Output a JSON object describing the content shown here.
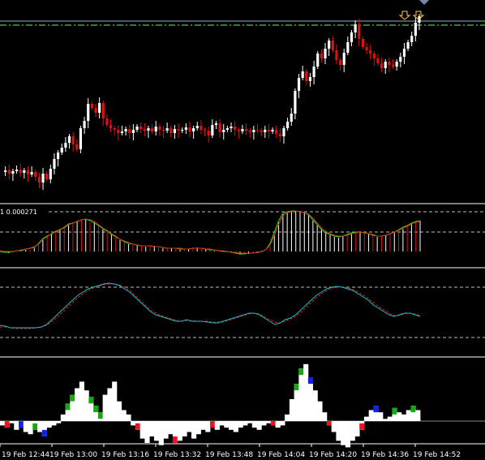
{
  "colors": {
    "background": "#000000",
    "bull_candle": "#ffffff",
    "bear_candle": "#dd1111",
    "resistance_line": "#22bb22",
    "level_line": "#9aaac8",
    "separator": "#ffffff",
    "dashed_level": "#bbbbbb",
    "arrow": "#ffcc33",
    "fast_line": "#22dd22",
    "slow_line": "#dd3311",
    "main_line": "#22bbcc",
    "signal_line": "#dd2222",
    "hist_white": "#ffffff",
    "hist_green": "#11aa11",
    "hist_blue": "#1122ee",
    "hist_red": "#ee1122"
  },
  "indicator_label": "1 0.000271",
  "time_axis": [
    "19 Feb 12:44",
    "19 Feb 13:00",
    "19 Feb 13:16",
    "19 Feb 13:32",
    "19 Feb 13:48",
    "19 Feb 14:04",
    "19 Feb 14:20",
    "19 Feb 14:36",
    "19 Feb 14:52"
  ],
  "price_closes": [
    212,
    210,
    214,
    211,
    209,
    213,
    210,
    215,
    212,
    218,
    225,
    214,
    221,
    208,
    196,
    188,
    182,
    176,
    168,
    178,
    184,
    158,
    149,
    128,
    133,
    139,
    127,
    146,
    154,
    158,
    160,
    164,
    162,
    159,
    164,
    160,
    156,
    159,
    161,
    158,
    162,
    156,
    160,
    161,
    158,
    164,
    159,
    161,
    160,
    157,
    162,
    158,
    155,
    160,
    161,
    167,
    154,
    152,
    163,
    160,
    158,
    156,
    160,
    162,
    159,
    161,
    163,
    160,
    161,
    163,
    160,
    162,
    160,
    165,
    168,
    158,
    150,
    140,
    112,
    96,
    88,
    100,
    95,
    82,
    66,
    72,
    60,
    50,
    62,
    74,
    80,
    65,
    52,
    40,
    30,
    48,
    58,
    62,
    66,
    72,
    78,
    84,
    76,
    80,
    82,
    76,
    70,
    60,
    52,
    44,
    28,
    20
  ],
  "macd_histogram": [
    310,
    310,
    312,
    311,
    310,
    309,
    308,
    308,
    306,
    302,
    296,
    292,
    288,
    286,
    282,
    279,
    277,
    274,
    272,
    270,
    270,
    274,
    274,
    277,
    283,
    286,
    288,
    293,
    296,
    299,
    301,
    302,
    302,
    303,
    304,
    303,
    303,
    305,
    306,
    306,
    306,
    307,
    308,
    307,
    307,
    305,
    305,
    307,
    307,
    308,
    309,
    309,
    310,
    311,
    311,
    312,
    314,
    313,
    313,
    312,
    312,
    311,
    310,
    304,
    290,
    274,
    264,
    262,
    260,
    261,
    260,
    262,
    264,
    272,
    278,
    282,
    286,
    290,
    292,
    293,
    291,
    290,
    287,
    286,
    285,
    286,
    288,
    290,
    292,
    291,
    290,
    288,
    286,
    284,
    282,
    279,
    276,
    273,
    272
  ],
  "macd_fast": [
    310,
    311,
    311,
    310,
    309,
    309,
    307,
    306,
    305,
    300,
    294,
    291,
    289,
    285,
    283,
    280,
    276,
    275,
    273,
    271,
    270,
    272,
    275,
    278,
    282,
    285,
    289,
    292,
    295,
    298,
    300,
    301,
    302,
    303,
    303,
    303,
    304,
    304,
    305,
    306,
    306,
    306,
    307,
    307,
    307,
    306,
    306,
    306,
    307,
    308,
    308,
    309,
    310,
    310,
    311,
    312,
    313,
    313,
    312,
    312,
    311,
    310,
    308,
    300,
    286,
    272,
    263,
    261,
    260,
    260,
    261,
    262,
    265,
    271,
    277,
    283,
    287,
    289,
    291,
    292,
    291,
    289,
    287,
    286,
    286,
    287,
    288,
    290,
    291,
    291,
    290,
    288,
    286,
    283,
    280,
    278,
    275,
    273,
    272
  ],
  "macd_slow": [
    309,
    310,
    310,
    310,
    309,
    308,
    307,
    306,
    304,
    301,
    295,
    292,
    288,
    286,
    283,
    281,
    277,
    275,
    273,
    271,
    270,
    271,
    273,
    277,
    281,
    284,
    288,
    291,
    295,
    297,
    299,
    301,
    302,
    303,
    303,
    303,
    304,
    304,
    305,
    306,
    306,
    306,
    306,
    307,
    307,
    306,
    306,
    306,
    307,
    307,
    308,
    309,
    309,
    310,
    311,
    311,
    312,
    312,
    312,
    312,
    311,
    310,
    308,
    302,
    290,
    276,
    266,
    262,
    261,
    260,
    261,
    262,
    264,
    269,
    275,
    281,
    285,
    288,
    290,
    291,
    291,
    290,
    288,
    287,
    286,
    287,
    288,
    289,
    291,
    291,
    290,
    288,
    286,
    284,
    281,
    279,
    276,
    274,
    273
  ],
  "osc_main": [
    401,
    402,
    404,
    404,
    404,
    404,
    404,
    404,
    403,
    400,
    394,
    388,
    382,
    376,
    370,
    364,
    360,
    356,
    354,
    352,
    350,
    349,
    350,
    352,
    356,
    360,
    366,
    372,
    378,
    384,
    388,
    390,
    392,
    394,
    396,
    396,
    394,
    396,
    396,
    396,
    397,
    398,
    398,
    396,
    394,
    392,
    390,
    388,
    386,
    386,
    388,
    392,
    396,
    400,
    398,
    394,
    392,
    388,
    382,
    376,
    370,
    364,
    360,
    356,
    354,
    353,
    354,
    356,
    358,
    362,
    366,
    370,
    376,
    380,
    384,
    388,
    390,
    388,
    386,
    386,
    388,
    390
  ],
  "osc_signal": [
    403,
    403,
    404,
    405,
    405,
    405,
    405,
    404,
    403,
    401,
    396,
    391,
    385,
    379,
    373,
    367,
    362,
    358,
    355,
    353,
    351,
    350,
    350,
    351,
    354,
    358,
    364,
    370,
    376,
    382,
    386,
    389,
    391,
    393,
    395,
    396,
    395,
    395,
    396,
    396,
    396,
    397,
    397,
    397,
    395,
    393,
    391,
    389,
    387,
    386,
    387,
    391,
    394,
    397,
    398,
    396,
    393,
    390,
    385,
    379,
    373,
    367,
    362,
    358,
    355,
    354,
    354,
    355,
    357,
    360,
    364,
    368,
    373,
    378,
    382,
    386,
    389,
    389,
    387,
    386,
    387,
    389
  ],
  "hist_main": [
    -4,
    -6,
    -2,
    -8,
    -6,
    -10,
    -12,
    -8,
    -10,
    -14,
    -6,
    -4,
    -2,
    6,
    16,
    24,
    30,
    36,
    28,
    22,
    14,
    8,
    24,
    30,
    36,
    18,
    10,
    6,
    -4,
    -8,
    -16,
    -20,
    -14,
    -18,
    -22,
    -16,
    -12,
    -20,
    -18,
    -14,
    -10,
    -16,
    -12,
    -8,
    -10,
    -6,
    -8,
    -4,
    -6,
    -8,
    -10,
    -6,
    -4,
    -2,
    -6,
    -8,
    -4,
    -2,
    -4,
    -6,
    -4,
    6,
    20,
    34,
    48,
    52,
    40,
    28,
    18,
    8,
    -4,
    -10,
    -18,
    -22,
    -24,
    -18,
    -14,
    -8,
    4,
    10,
    14,
    8,
    2,
    4,
    12,
    8,
    6,
    10,
    14,
    10
  ],
  "hist_tone": [
    "w",
    "r",
    "w",
    "w",
    "b",
    "w",
    "w",
    "g",
    "w",
    "b",
    "w",
    "w",
    "w",
    "w",
    "g",
    "g",
    "w",
    "w",
    "w",
    "g",
    "g",
    "g",
    "w",
    "w",
    "w",
    "w",
    "w",
    "w",
    "w",
    "r",
    "w",
    "w",
    "w",
    "w",
    "w",
    "w",
    "w",
    "r",
    "w",
    "w",
    "w",
    "w",
    "w",
    "w",
    "w",
    "r",
    "w",
    "w",
    "w",
    "w",
    "w",
    "w",
    "w",
    "w",
    "w",
    "w",
    "w",
    "w",
    "r",
    "w",
    "w",
    "w",
    "w",
    "g",
    "g",
    "w",
    "b",
    "w",
    "w",
    "w",
    "r",
    "w",
    "w",
    "w",
    "w",
    "w",
    "w",
    "r",
    "w",
    "w",
    "b",
    "w",
    "w",
    "w",
    "g",
    "w",
    "w",
    "w",
    "g",
    "w"
  ]
}
